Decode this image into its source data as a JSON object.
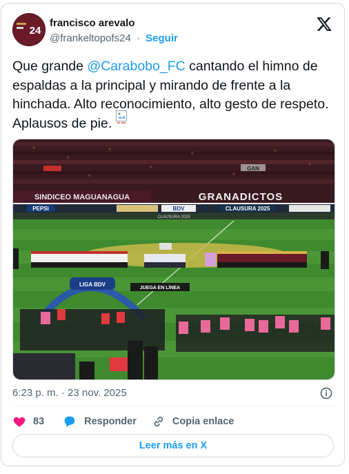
{
  "author": {
    "name": "francisco arevalo",
    "handle": "@frankeltopofs24",
    "separator": "·",
    "follow_label": "Seguir",
    "avatar_text": "24"
  },
  "tweet": {
    "text_before": "Que grande ",
    "mention": "@Carabobo_FC",
    "text_after": " cantando el himno de espaldas a la principal y mirando de frente a la hinchada. Alto reconocimiento, alto gesto de respeto. Aplausos de pie."
  },
  "photo": {
    "banner_left": "SINDICEO MAGUANAGUA",
    "banner_right": "GRANADICTOS",
    "banner_top": "GAN",
    "ad_pepsi": "PEPSI",
    "ad_bdv": "BDV",
    "ad_clausura": "CLAUSURA 2025",
    "ad_clausura_small": "CLAUSURA 2025",
    "ad_juego": "JUEGA EN LÍNEA",
    "arch_label": "LIGA BDV"
  },
  "timestamp": "6:23 p. m. · 23 nov. 2025",
  "actions": {
    "likes": "83",
    "reply_label": "Responder",
    "copy_label": "Copia enlace"
  },
  "read_more": "Leer más en X",
  "colors": {
    "accent": "#1d9bf0",
    "like": "#f91880",
    "text": "#0f1419",
    "muted": "#536471",
    "border": "#cfd9de"
  },
  "icons": {
    "logo": "x-logo-icon",
    "like": "heart-icon",
    "reply": "reply-bubble-icon",
    "copy": "link-icon",
    "info": "info-icon"
  }
}
